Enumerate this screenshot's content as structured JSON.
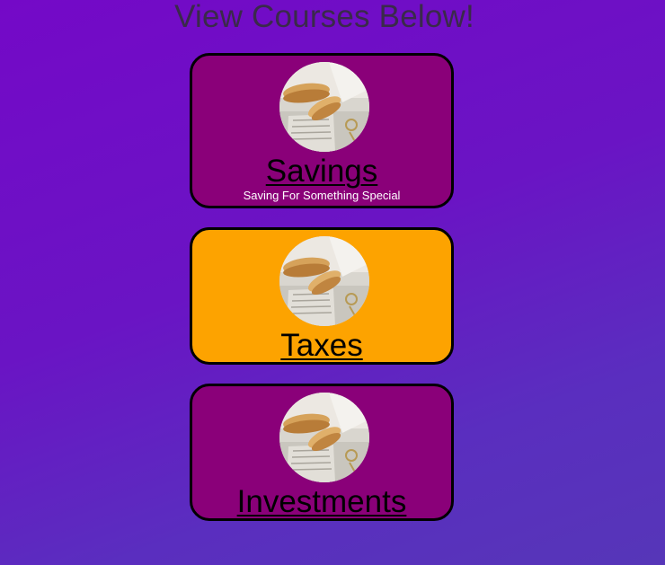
{
  "header": {
    "title": "View Courses Below!"
  },
  "colors": {
    "card_purple": "#8a0079",
    "card_orange": "#fda300",
    "title_text": "#3a2a4a",
    "background_start": "#7409c7",
    "background_end": "#5636b8"
  },
  "courses": [
    {
      "title": "Savings",
      "subtitle": "Saving For Something Special",
      "color": "purple",
      "image_icon": "savings-course-image"
    },
    {
      "title": "Taxes",
      "subtitle": "",
      "color": "orange",
      "image_icon": "taxes-course-image"
    },
    {
      "title": "Investments",
      "subtitle": "",
      "color": "purple",
      "image_icon": "investments-course-image"
    }
  ]
}
